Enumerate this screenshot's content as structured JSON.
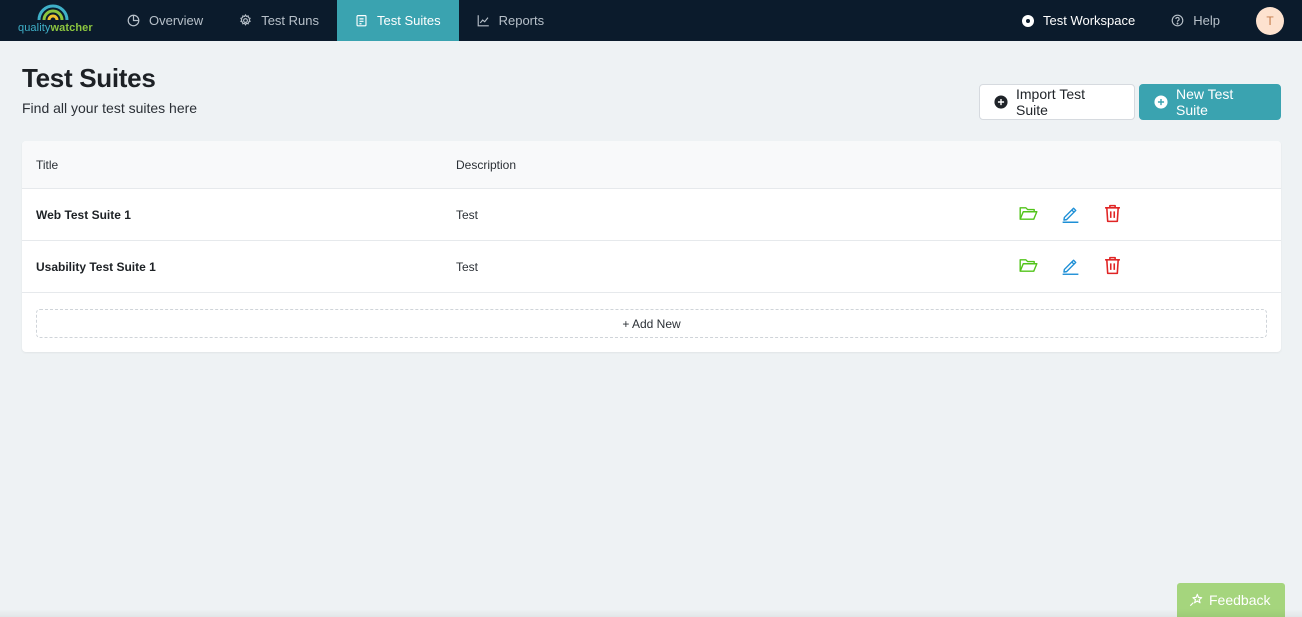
{
  "brand": {
    "logo_part1": "quality",
    "logo_part2": "watcher"
  },
  "nav": {
    "items": [
      {
        "label": "Overview",
        "icon": "chart-pie-icon"
      },
      {
        "label": "Test Runs",
        "icon": "gear-icon"
      },
      {
        "label": "Test Suites",
        "icon": "clipboard-icon",
        "active": true
      },
      {
        "label": "Reports",
        "icon": "line-chart-icon"
      }
    ],
    "workspace": "Test Workspace",
    "help": "Help",
    "avatar_initial": "T"
  },
  "page": {
    "title": "Test Suites",
    "subtitle": "Find all your test suites here",
    "import_button": "Import Test Suite",
    "new_button": "New Test Suite"
  },
  "table": {
    "columns": [
      "Title",
      "Description"
    ],
    "rows": [
      {
        "title": "Web Test Suite 1",
        "description": "Test"
      },
      {
        "title": "Usability Test Suite 1",
        "description": "Test"
      }
    ],
    "add_new": "+ Add New"
  },
  "feedback": "Feedback",
  "colors": {
    "topbar": "#0b1b2c",
    "accent": "#3aa3b0",
    "open": "#52c41a",
    "edit": "#1d8fd6",
    "delete": "#e02424",
    "feedback": "#a5d57d"
  }
}
